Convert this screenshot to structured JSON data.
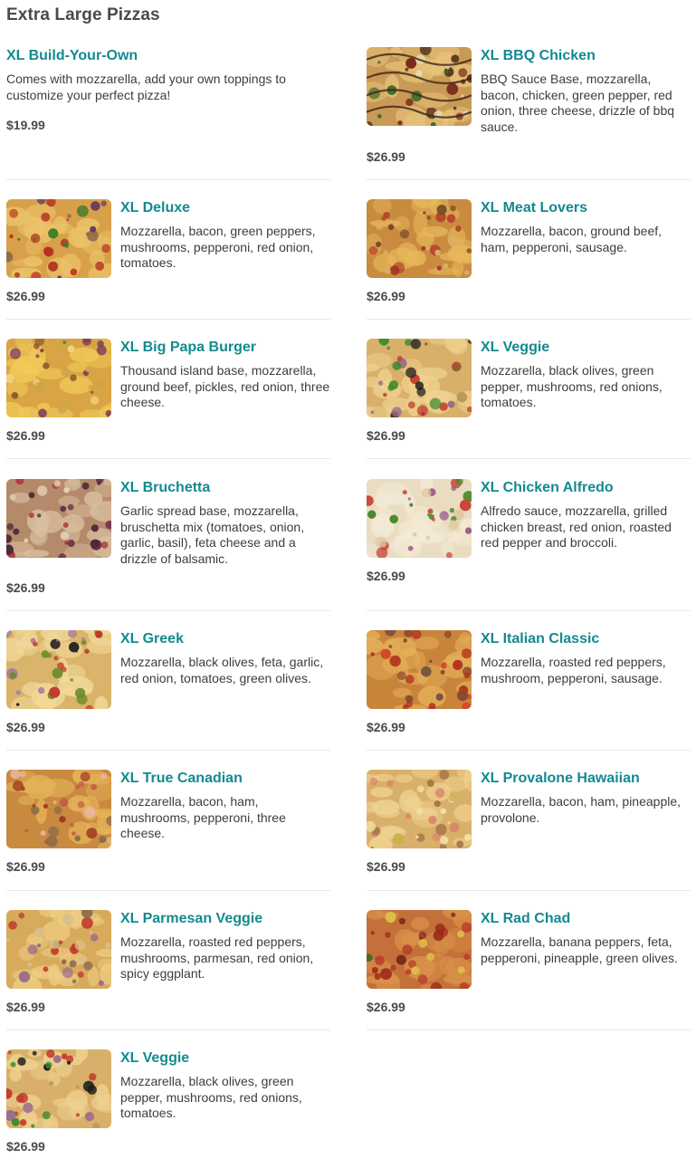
{
  "section": {
    "title": "Extra Large Pizzas"
  },
  "items": [
    {
      "name": "XL Build-Your-Own",
      "description": "Comes with mozzarella, add your own toppings to customize your perfect pizza!",
      "price": "$19.99"
    },
    {
      "name": "XL BBQ Chicken",
      "description": "BBQ Sauce Base, mozzarella, bacon, chicken, green pepper, red onion, three cheese, drizzle of bbq sauce.",
      "price": "$26.99"
    },
    {
      "name": "XL Deluxe",
      "description": "Mozzarella, bacon, green peppers, mushrooms, pepperoni, red onion, tomatoes.",
      "price": "$26.99"
    },
    {
      "name": "XL Meat Lovers",
      "description": "Mozzarella, bacon, ground beef, ham, pepperoni, sausage.",
      "price": "$26.99"
    },
    {
      "name": "XL Big Papa Burger",
      "description": "Thousand island base, mozzarella, ground beef, pickles, red onion, three cheese.",
      "price": "$26.99"
    },
    {
      "name": "XL Veggie",
      "description": "Mozzarella, black olives, green pepper, mushrooms, red onions, tomatoes.",
      "price": "$26.99"
    },
    {
      "name": "XL Bruchetta",
      "description": "Garlic spread base, mozzarella, bruschetta mix (tomatoes, onion, garlic, basil), feta cheese and a drizzle of balsamic.",
      "price": "$26.99"
    },
    {
      "name": "XL Chicken Alfredo",
      "description": "Alfredo sauce, mozzarella, grilled chicken breast, red onion, roasted red pepper and broccoli.",
      "price": "$26.99"
    },
    {
      "name": "XL Greek",
      "description": "Mozzarella, black olives, feta, garlic, red onion, tomatoes, green olives.",
      "price": "$26.99"
    },
    {
      "name": "XL Italian Classic",
      "description": "Mozzarella, roasted red peppers, mushroom, pepperoni, sausage.",
      "price": "$26.99"
    },
    {
      "name": "XL True Canadian",
      "description": "Mozzarella, bacon, ham, mushrooms, pepperoni, three cheese.",
      "price": "$26.99"
    },
    {
      "name": "XL Provalone Hawaiian",
      "description": "Mozzarella, bacon, ham, pineapple, provolone.",
      "price": "$26.99"
    },
    {
      "name": "XL Parmesan Veggie",
      "description": "Mozzarella, roasted red peppers, mushrooms, parmesan, red onion, spicy eggplant.",
      "price": "$26.99"
    },
    {
      "name": "XL Rad Chad",
      "description": "Mozzarella, banana peppers, feta, pepperoni, pineapple, green olives.",
      "price": "$26.99"
    },
    {
      "name": "XL Veggie",
      "description": "Mozzarella, black olives, green pepper, mushrooms, red onions, tomatoes.",
      "price": "$26.99"
    }
  ]
}
